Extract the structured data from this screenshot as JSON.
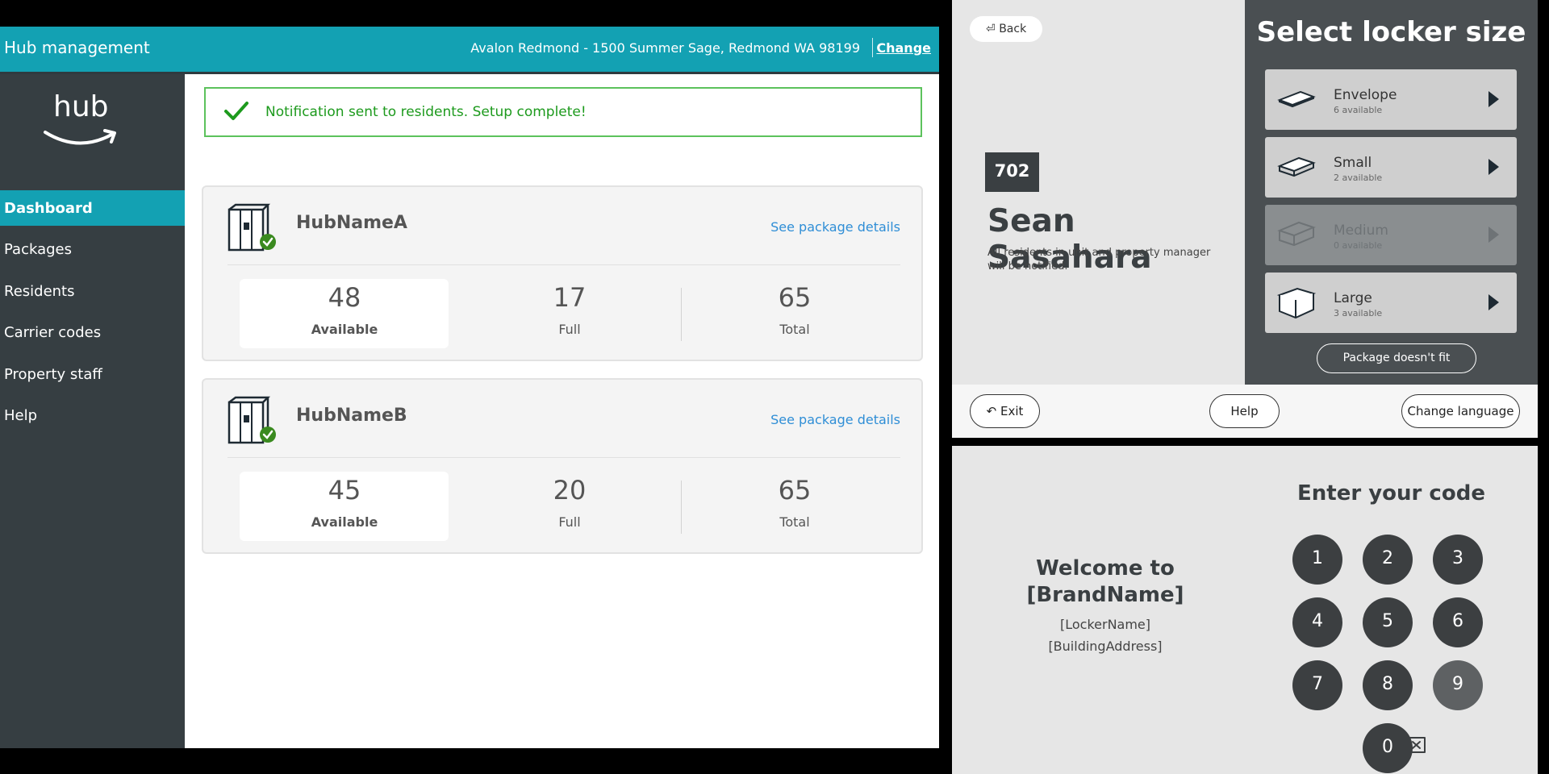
{
  "hub_management": {
    "header": {
      "title": "Hub management",
      "address": "Avalon Redmond - 1500 Summer Sage, Redmond WA 98199",
      "change_label": "Change"
    },
    "logo_text": "hub",
    "sidebar": {
      "items": [
        {
          "label": "Dashboard",
          "active": true
        },
        {
          "label": "Packages",
          "active": false
        },
        {
          "label": "Residents",
          "active": false
        },
        {
          "label": "Carrier codes",
          "active": false
        },
        {
          "label": "Property staff",
          "active": false
        },
        {
          "label": "Help",
          "active": false
        }
      ]
    },
    "notification": "Notification sent to residents. Setup complete!",
    "hubs": [
      {
        "name": "HubNameA",
        "link": "See package details",
        "available": "48",
        "available_label": "Available",
        "full": "17",
        "full_label": "Full",
        "total": "65",
        "total_label": "Total"
      },
      {
        "name": "HubNameB",
        "link": "See package details",
        "available": "45",
        "available_label": "Available",
        "full": "20",
        "full_label": "Full",
        "total": "65",
        "total_label": "Total"
      }
    ],
    "colors": {
      "accent": "#13a1b3",
      "sidebar": "#363e42",
      "success": "#1d9a1d",
      "link": "#2f8ed6"
    }
  },
  "locker_kiosk": {
    "back_label": "Back",
    "unit": "702",
    "resident_name": "Sean Sasahara",
    "notify_text": "All residents in unit and property manager will be notified.",
    "title": "Select locker size",
    "sizes": [
      {
        "name": "Envelope",
        "available": "6 available",
        "enabled": true
      },
      {
        "name": "Small",
        "available": "2 available",
        "enabled": true
      },
      {
        "name": "Medium",
        "available": "0 available",
        "enabled": false
      },
      {
        "name": "Large",
        "available": "3 available",
        "enabled": true
      }
    ],
    "doesnt_fit_label": "Package doesn't fit",
    "footer": {
      "exit_label": "Exit",
      "help_label": "Help",
      "language_label": "Change language"
    }
  },
  "code_entry": {
    "welcome": "Welcome to [BrandName]",
    "locker_name": "[LockerName]",
    "building_address": "[BuildingAddress]",
    "title": "Enter your code",
    "keys": [
      "1",
      "2",
      "3",
      "4",
      "5",
      "6",
      "7",
      "8",
      "9",
      "0"
    ]
  }
}
